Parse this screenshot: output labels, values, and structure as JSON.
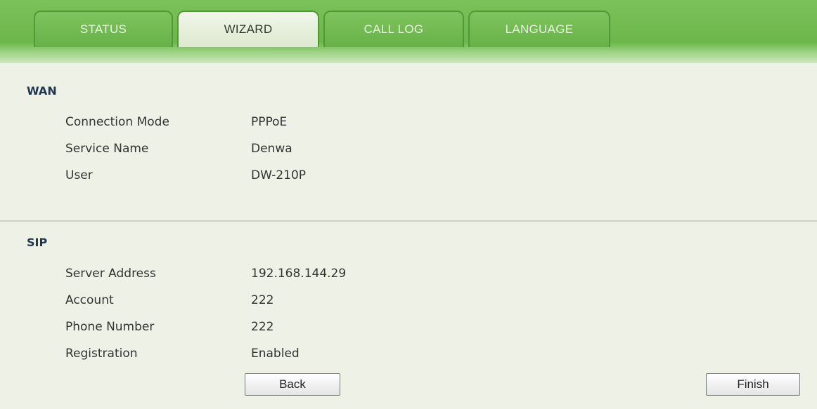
{
  "tabs": [
    {
      "label": "STATUS",
      "active": false
    },
    {
      "label": "WIZARD",
      "active": true
    },
    {
      "label": "CALL LOG",
      "active": false
    },
    {
      "label": "LANGUAGE",
      "active": false
    }
  ],
  "wan": {
    "title": "WAN",
    "rows": [
      {
        "label": "Connection Mode",
        "value": "PPPoE"
      },
      {
        "label": "Service Name",
        "value": "Denwa"
      },
      {
        "label": "User",
        "value": "DW-210P"
      }
    ]
  },
  "sip": {
    "title": "SIP",
    "rows": [
      {
        "label": "Server Address",
        "value": "192.168.144.29"
      },
      {
        "label": "Account",
        "value": "222"
      },
      {
        "label": "Phone Number",
        "value": "222"
      },
      {
        "label": "Registration",
        "value": "Enabled"
      }
    ]
  },
  "buttons": {
    "back": "Back",
    "finish": "Finish"
  },
  "colors": {
    "tab_green": "#6cb64b",
    "active_tab": "#eaf1e0",
    "background": "#eef2e6",
    "section_title": "#1f3550"
  }
}
